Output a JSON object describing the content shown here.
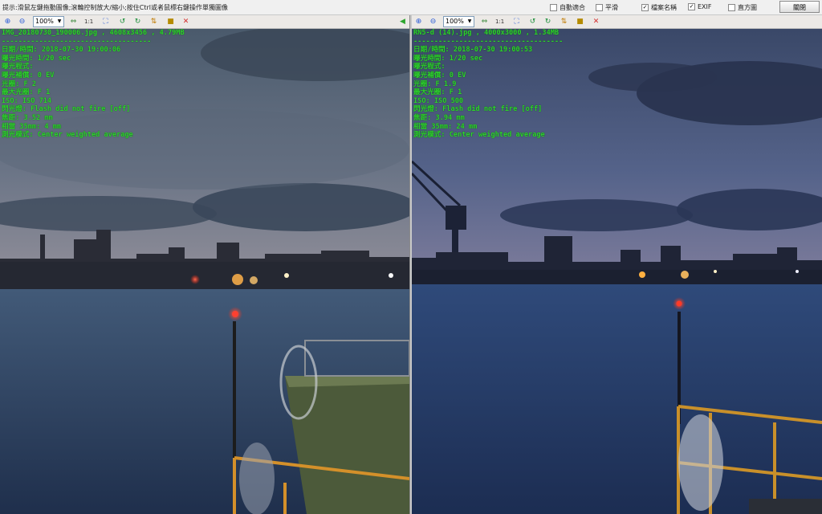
{
  "topbar": {
    "hint": "提示:滑鼠左鍵拖動圖像;滾輪控制放大/縮小;按住Ctrl或者鼠標右鍵操作單獨圖像",
    "options": [
      {
        "label": "自動適合",
        "checked": false
      },
      {
        "label": "平滑",
        "checked": false
      },
      {
        "label": "檔案名稱",
        "checked": true
      },
      {
        "label": "EXIF",
        "checked": true
      },
      {
        "label": "直方圖",
        "checked": false
      }
    ],
    "close_label": "關閉"
  },
  "toolbar": {
    "zoom_value": "100%",
    "ratio_label": "1:1",
    "icons": [
      "zoom-in-icon",
      "zoom-out-icon",
      "fit-icon",
      "actual-size-icon",
      "full-screen-icon",
      "rotate-left-icon",
      "rotate-right-icon",
      "flip-icon",
      "save-icon",
      "close-icon"
    ]
  },
  "left_panel": {
    "exif": [
      "IMG_20180730_190006.jpg , 4608x3456 , 4.79MB",
      "------------------------------------",
      "日期/時間: 2018-07-30 19:00:06",
      "曝光時間: 1/20 sec",
      "曝光程式:",
      "曝光補償: 0 EV",
      "光圈: F 2",
      "最大光圈: F 1",
      "ISO: ISO 714",
      "閃光燈: Flash did not fire [off]",
      "焦距: 3.52 mm",
      "相當 35mm: 4 mm",
      "測光模式: Center weighted average"
    ]
  },
  "right_panel": {
    "exif": [
      "RN5-d (14).jpg , 4000x3000 , 1.34MB",
      "------------------------------------",
      "日期/時間: 2018-07-30 19:00:53",
      "曝光時間: 1/20 sec",
      "曝光程式:",
      "曝光補償: 0 EV",
      "光圈: F 1.9",
      "最大光圈: F 1",
      "ISO: ISO 500",
      "閃光燈: Flash did not fire [off]",
      "焦距: 3.94 mm",
      "相當 35mm: 24 mm",
      "測光模式: Center weighted average"
    ]
  },
  "colors": {
    "exif_text": "#2ed12e",
    "left_sky": "#4e5d6c",
    "left_water": "#2e405c",
    "right_sky": "#3b4a6a",
    "right_water": "#24375c"
  }
}
